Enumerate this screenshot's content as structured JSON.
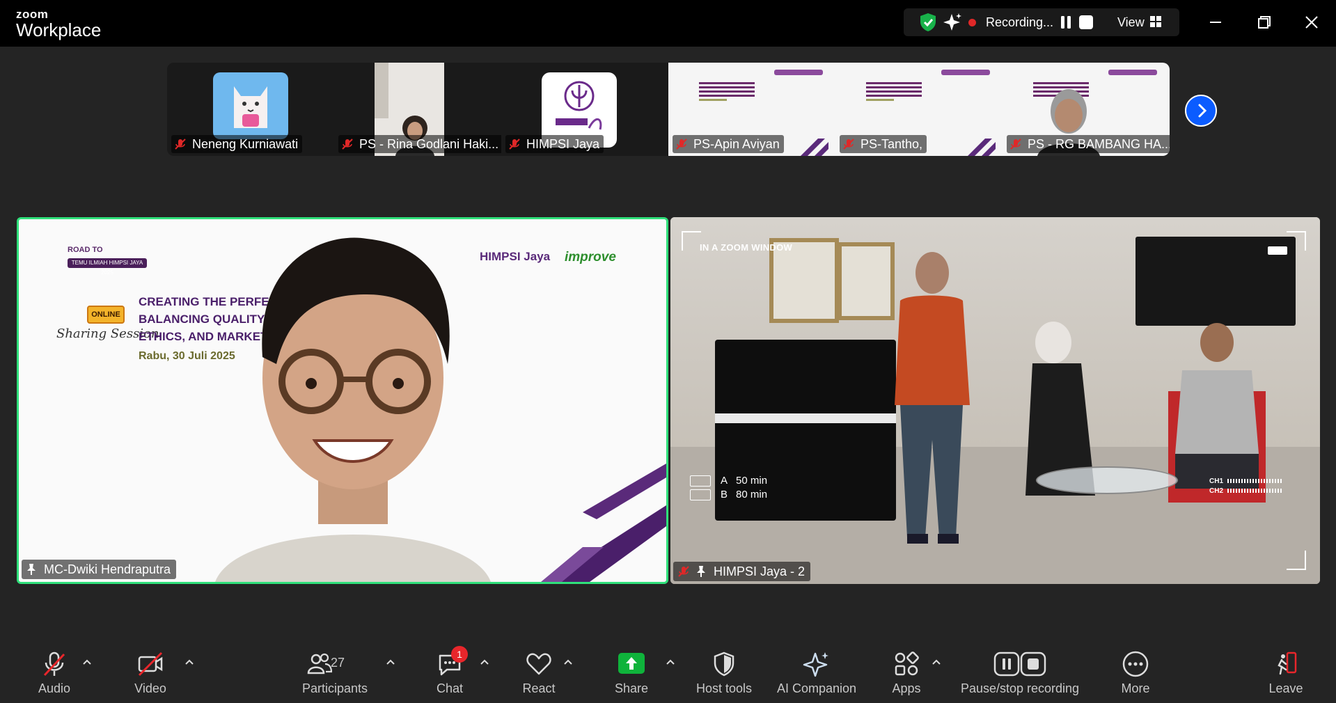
{
  "app": {
    "brand_small": "zoom",
    "brand_big": "Workplace",
    "recording_label": "Recording...",
    "view_label": "View"
  },
  "thumbnails": [
    {
      "name": "Neneng Kurniawati",
      "kind": "avatar-cat"
    },
    {
      "name": "PS - Rina Godlani Haki...",
      "kind": "camera"
    },
    {
      "name": "HIMPSI Jaya",
      "kind": "avatar-logo"
    },
    {
      "name": "PS-Apin Aviyan",
      "kind": "slide"
    },
    {
      "name": "PS-Tantho,",
      "kind": "slide"
    },
    {
      "name": "PS - RG BAMBANG HA...",
      "kind": "slide-camera"
    }
  ],
  "main": {
    "left": {
      "name": "MC-Dwiki Hendraputra",
      "slide": {
        "road_to": "ROAD TO",
        "road_sub": "TEMU ILMIAH HIMPSI JAYA 2025",
        "online": "ONLINE",
        "sharing": "Sharing Session",
        "title_1": "CREATING THE PERFECT EA",
        "title_2": "BALANCING QUALITY, PRO",
        "title_3": "ETHICS, AND MARKET PR",
        "date": "Rabu, 30 Juli 2025",
        "logo_himpsi": "HIMPSI Jaya",
        "logo_improve": "improve"
      }
    },
    "right": {
      "name": "HIMPSI Jaya - 2",
      "overlay": {
        "window_label": "IN A ZOOM WINDOW",
        "a_label": "A",
        "a_value": "50 min",
        "b_label": "B",
        "b_value": "80 min",
        "ch1": "CH1",
        "ch2": "CH2"
      }
    }
  },
  "toolbar": {
    "audio": "Audio",
    "video": "Video",
    "participants": "Participants",
    "participants_count": "27",
    "chat": "Chat",
    "chat_badge": "1",
    "react": "React",
    "share": "Share",
    "host_tools": "Host tools",
    "ai_companion": "AI Companion",
    "apps": "Apps",
    "pause_stop": "Pause/stop recording",
    "more": "More",
    "leave": "Leave"
  },
  "colors": {
    "background": "#242424",
    "active_speaker_border": "#2fe07a",
    "recording_dot": "#e02828",
    "share_green": "#0fb33b",
    "leave_red": "#e8262b",
    "next_button_blue": "#0b5cff"
  },
  "icons": [
    "shield-check-icon",
    "sparkle-icon",
    "pause-icon",
    "stop-icon",
    "grid-view-icon",
    "minimize-icon",
    "maximize-icon",
    "close-icon",
    "mic-off-icon",
    "pin-icon",
    "chevron-right-icon",
    "microphone-muted-icon",
    "video-off-icon",
    "participants-icon",
    "chat-icon",
    "heart-icon",
    "share-arrow-icon",
    "shield-icon",
    "ai-sparkle-icon",
    "apps-icon",
    "record-controls-icon",
    "ellipsis-icon",
    "leave-icon",
    "caret-up-icon"
  ]
}
